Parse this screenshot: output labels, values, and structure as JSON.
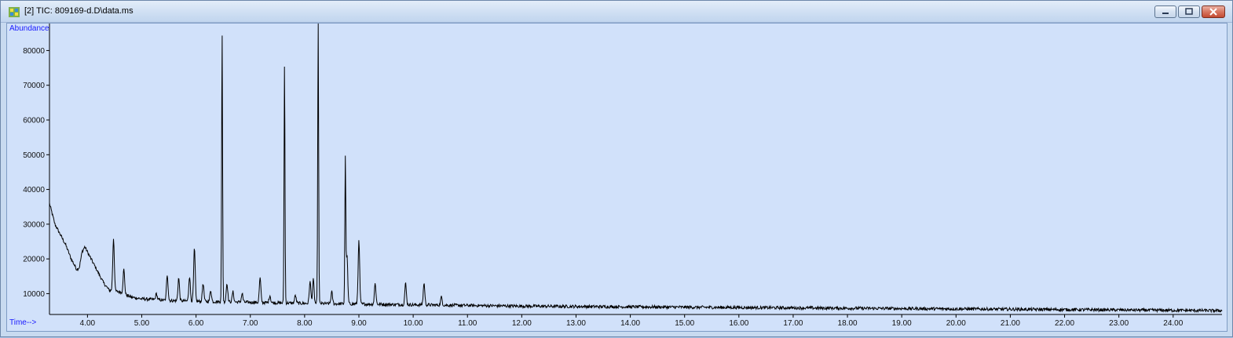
{
  "window": {
    "title": "[2] TIC: 809169-d.D\\data.ms",
    "icon": "chromatogram-app-icon"
  },
  "colors": {
    "plot_bg": "#d1e1fa",
    "trace": "#000000",
    "axis_title": "#1a1aff"
  },
  "chart_data": {
    "type": "line",
    "xlabel": "Time-->",
    "ylabel": "Abundance",
    "xlim": [
      3.3,
      24.9
    ],
    "ylim": [
      4000,
      88000
    ],
    "x_ticks": [
      "4.00",
      "5.00",
      "6.00",
      "7.00",
      "8.00",
      "9.00",
      "10.00",
      "11.00",
      "12.00",
      "13.00",
      "14.00",
      "15.00",
      "16.00",
      "17.00",
      "18.00",
      "19.00",
      "20.00",
      "21.00",
      "22.00",
      "23.00",
      "24.00"
    ],
    "y_ticks": [
      "10000",
      "20000",
      "30000",
      "40000",
      "50000",
      "60000",
      "70000",
      "80000"
    ],
    "grid": false,
    "legend": "none",
    "series": [
      {
        "baseline": [
          [
            3.3,
            36000
          ],
          [
            3.4,
            30000
          ],
          [
            3.5,
            27000
          ],
          [
            3.6,
            24000
          ],
          [
            3.7,
            20000
          ],
          [
            3.8,
            17000
          ],
          [
            3.85,
            17500
          ],
          [
            3.9,
            22000
          ],
          [
            3.95,
            23500
          ],
          [
            4.0,
            22000
          ],
          [
            4.1,
            19000
          ],
          [
            4.2,
            16000
          ],
          [
            4.3,
            13000
          ],
          [
            4.4,
            11000
          ],
          [
            4.6,
            10500
          ],
          [
            4.8,
            9000
          ],
          [
            5.0,
            8500
          ],
          [
            5.5,
            8000
          ],
          [
            6.0,
            7800
          ],
          [
            7.0,
            7500
          ],
          [
            8.0,
            7200
          ],
          [
            9.0,
            7000
          ],
          [
            10.0,
            6800
          ],
          [
            11.0,
            6600
          ],
          [
            12.0,
            6400
          ],
          [
            13.0,
            6300
          ],
          [
            14.0,
            6200
          ],
          [
            15.0,
            6100
          ],
          [
            16.0,
            6000
          ],
          [
            17.0,
            5900
          ],
          [
            18.0,
            5800
          ],
          [
            19.0,
            5700
          ],
          [
            20.0,
            5600
          ],
          [
            21.0,
            5500
          ],
          [
            22.0,
            5400
          ],
          [
            23.0,
            5300
          ],
          [
            24.0,
            5200
          ],
          [
            24.9,
            5100
          ]
        ],
        "peaks": [
          [
            4.48,
            26000
          ],
          [
            4.67,
            17000
          ],
          [
            5.27,
            10000
          ],
          [
            5.47,
            15500
          ],
          [
            5.68,
            14500
          ],
          [
            5.88,
            15000
          ],
          [
            5.97,
            23000
          ],
          [
            6.13,
            13000
          ],
          [
            6.27,
            11000
          ],
          [
            6.48,
            86000
          ],
          [
            6.57,
            13000
          ],
          [
            6.68,
            10500
          ],
          [
            6.85,
            10000
          ],
          [
            7.18,
            14500
          ],
          [
            7.36,
            9500
          ],
          [
            7.63,
            77000
          ],
          [
            7.83,
            9500
          ],
          [
            8.1,
            13500
          ],
          [
            8.16,
            14000
          ],
          [
            8.25,
            90000
          ],
          [
            8.5,
            10500
          ],
          [
            8.75,
            48000
          ],
          [
            8.78,
            21000
          ],
          [
            9.0,
            25000
          ],
          [
            9.3,
            13000
          ],
          [
            9.86,
            13000
          ],
          [
            10.2,
            13000
          ],
          [
            10.52,
            9000
          ]
        ]
      }
    ]
  }
}
